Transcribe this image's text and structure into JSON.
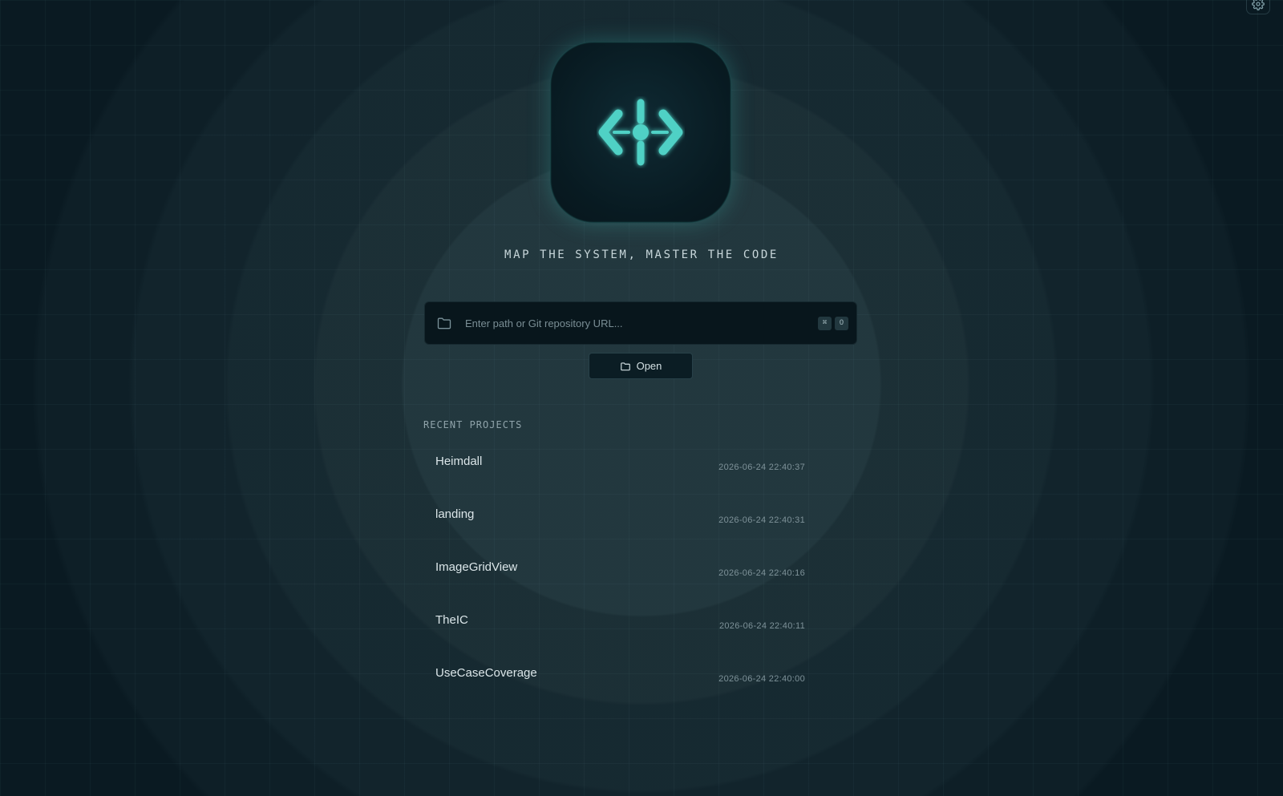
{
  "tagline": "MAP THE SYSTEM, MASTER THE CODE",
  "search": {
    "placeholder": "Enter path or Git repository URL...",
    "value": "",
    "shortcut_keys": [
      "⌘",
      "O"
    ]
  },
  "open_button": {
    "label": "Open"
  },
  "recent": {
    "title": "RECENT PROJECTS",
    "items": [
      {
        "name": "Heimdall",
        "time": "2026-06-24 22:40:37"
      },
      {
        "name": "landing",
        "time": "2026-06-24 22:40:31"
      },
      {
        "name": "ImageGridView",
        "time": "2026-06-24 22:40:16"
      },
      {
        "name": "TheIC",
        "time": "2026-06-24 22:40:11"
      },
      {
        "name": "UseCaseCoverage",
        "time": "2026-06-24 22:40:00"
      }
    ]
  },
  "icons": {
    "settings": "gear-icon",
    "logo": "code-compass-logo-icon",
    "search_folder": "folder-icon",
    "open_folder": "folder-icon"
  },
  "colors": {
    "accent": "#4fd1c5",
    "background": "#0a1a22"
  }
}
